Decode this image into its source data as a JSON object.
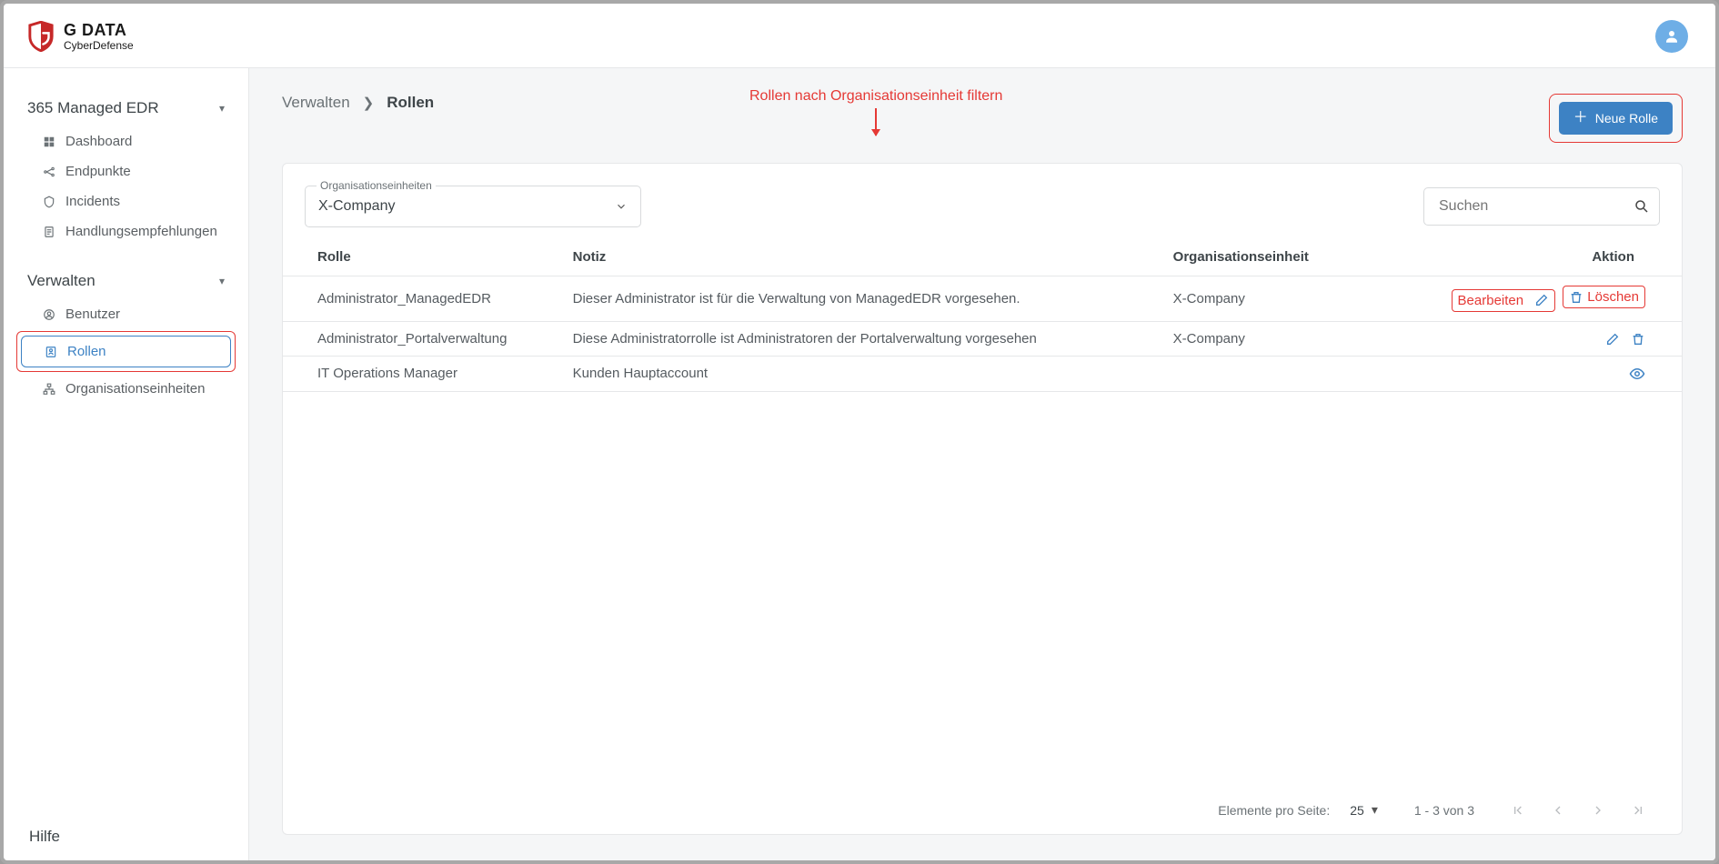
{
  "brand": {
    "line1": "G DATA",
    "line2": "CyberDefense"
  },
  "sidebar": {
    "sections": [
      {
        "title": "365 Managed EDR",
        "items": [
          {
            "label": "Dashboard",
            "icon": "dashboard-icon"
          },
          {
            "label": "Endpunkte",
            "icon": "endpoints-icon"
          },
          {
            "label": "Incidents",
            "icon": "incidents-icon"
          },
          {
            "label": "Handlungsempfehlungen",
            "icon": "recommendations-icon"
          }
        ]
      },
      {
        "title": "Verwalten",
        "items": [
          {
            "label": "Benutzer",
            "icon": "users-icon"
          },
          {
            "label": "Rollen",
            "icon": "roles-icon",
            "active": true,
            "highlight": true
          },
          {
            "label": "Organisationseinheiten",
            "icon": "orgunits-icon"
          }
        ]
      }
    ],
    "help": "Hilfe"
  },
  "breadcrumb": {
    "parent": "Verwalten",
    "current": "Rollen"
  },
  "annotations": {
    "filter_hint": "Rollen nach Organisationseinheit filtern",
    "edit_label": "Bearbeiten",
    "delete_label": "Löschen"
  },
  "actions": {
    "new_role": "Neue Rolle"
  },
  "filters": {
    "org_label": "Organisationseinheiten",
    "org_selected": "X-Company",
    "search_placeholder": "Suchen"
  },
  "table": {
    "headers": {
      "role": "Rolle",
      "note": "Notiz",
      "orgunit": "Organisationseinheit",
      "action": "Aktion"
    },
    "rows": [
      {
        "role": "Administrator_ManagedEDR",
        "note": "Dieser Administrator ist für die Verwaltung von ManagedEDR vorgesehen.",
        "orgunit": "X-Company",
        "action_type": "edit_delete_annotated"
      },
      {
        "role": "Administrator_Portalverwaltung",
        "note": "Diese Administratorrolle ist Administratoren der Portalverwaltung vorgesehen",
        "orgunit": "X-Company",
        "action_type": "edit_delete"
      },
      {
        "role": "IT Operations Manager",
        "note": "Kunden Hauptaccount",
        "orgunit": "",
        "action_type": "view"
      }
    ]
  },
  "pagination": {
    "per_page_label": "Elemente pro Seite:",
    "per_page_value": "25",
    "range": "1 - 3 von 3"
  }
}
